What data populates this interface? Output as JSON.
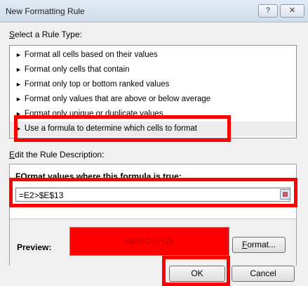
{
  "dialog": {
    "title": "New Formatting Rule",
    "help_button": "?",
    "close_button": "✕"
  },
  "rule_type": {
    "label_u": "S",
    "label_rest": "elect a Rule Type:",
    "items": [
      "Format all cells based on their values",
      "Format only cells that contain",
      "Format only top or bottom ranked values",
      "Format only values that are above or below average",
      "Format only unique or duplicate values",
      "Use a formula to determine which cells to format"
    ]
  },
  "description": {
    "label_u": "E",
    "label_rest": "dit the Rule Description:",
    "formula_heading_u": "O",
    "formula_heading_pre": "F",
    "formula_heading_rest": "rmat values where this formula is true:",
    "formula_value": "=E2>$E$13",
    "preview_label": "Preview:",
    "preview_sample": "AaBbCcYyZz",
    "format_button_u": "F",
    "format_button_rest": "ormat..."
  },
  "footer": {
    "ok_button": "OK",
    "cancel_button": "Cancel"
  },
  "colors": {
    "highlight_box": "#ff0000",
    "preview_fill": "#ff0000"
  }
}
